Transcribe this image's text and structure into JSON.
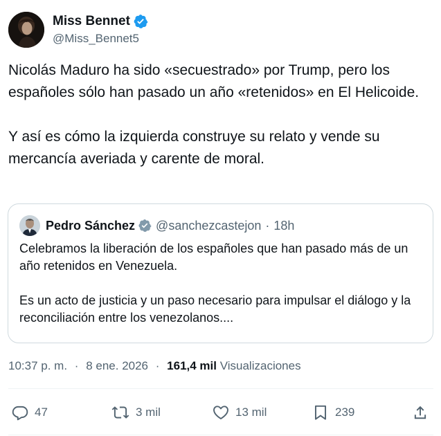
{
  "author": {
    "display_name": "Miss Bennet",
    "handle": "@Miss_Bennet5",
    "verified_icon": "verified-badge-icon",
    "accent_color": "#1d9bf0"
  },
  "tweet": {
    "paragraphs": [
      "Nicolás Maduro ha sido «secuestrado» por Trump, pero los españoles sólo han pasado un año «retenidos» en El Helicoide.",
      "Y así es cómo la izquierda construye su relato y vende su mercancía averiada y carente de moral."
    ]
  },
  "quoted": {
    "display_name": "Pedro Sánchez",
    "handle": "@sanchezcastejon",
    "separator": "·",
    "time": "18h",
    "verified_icon": "verified-badge-gray-icon",
    "paragraphs": [
      "Celebramos la liberación de los españoles que han pasado más de un año retenidos en Venezuela.",
      "Es un acto de justicia y un paso necesario para impulsar el diálogo y la reconciliación entre los venezolanos...."
    ]
  },
  "meta": {
    "time": "10:37 p. m.",
    "separator": "·",
    "date": "8 ene. 2026",
    "views_count": "161,4 mil",
    "views_label": "Visualizaciones"
  },
  "actions": {
    "replies": "47",
    "retweets": "3 mil",
    "likes": "13 mil",
    "bookmarks": "239"
  },
  "colors": {
    "text": "#0f1419",
    "secondary": "#536471",
    "border": "#cfd9de",
    "verified_gray": "#829aab"
  }
}
